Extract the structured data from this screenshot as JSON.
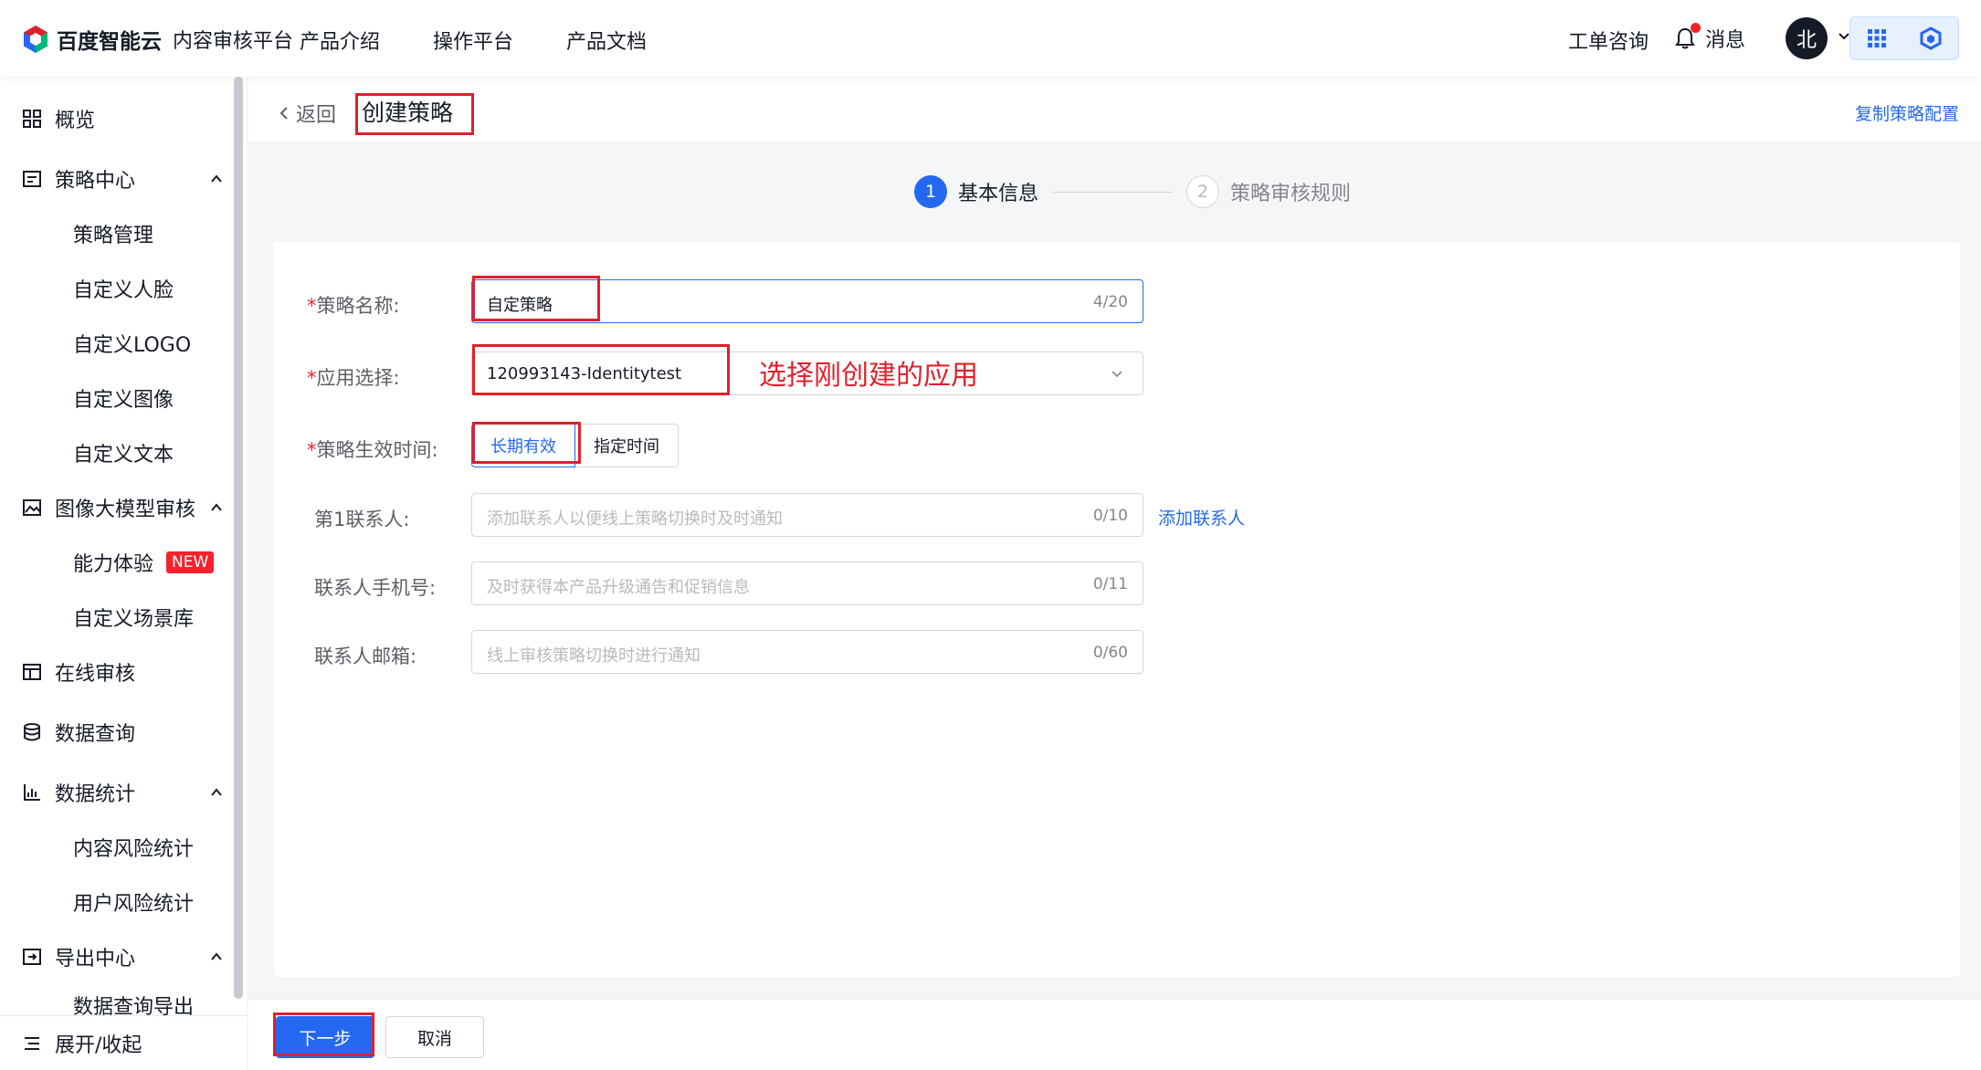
{
  "header": {
    "brand": "百度智能云",
    "product": "内容审核平台",
    "nav": [
      "产品介绍",
      "操作平台",
      "产品文档"
    ],
    "ticket": "工单咨询",
    "messages": "消息",
    "avatar_initial": "北"
  },
  "sidebar": {
    "overview": "概览",
    "strategy_center": "策略中心",
    "strategy_items": [
      "策略管理",
      "自定义人脸",
      "自定义LOGO",
      "自定义图像",
      "自定义文本"
    ],
    "image_model": "图像大模型审核",
    "image_model_items": [
      "能力体验",
      "自定义场景库"
    ],
    "new_badge": "NEW",
    "online_review": "在线审核",
    "data_query": "数据查询",
    "data_stats": "数据统计",
    "data_stats_items": [
      "内容风险统计",
      "用户风险统计"
    ],
    "export_center": "导出中心",
    "export_items": [
      "数据查询导出"
    ],
    "toggle": "展开/收起"
  },
  "page": {
    "back": "返回",
    "title": "创建策略",
    "copy_config": "复制策略配置"
  },
  "steps": [
    {
      "num": "1",
      "label": "基本信息"
    },
    {
      "num": "2",
      "label": "策略审核规则"
    }
  ],
  "form": {
    "required_mark": "*",
    "name_label": "策略名称:",
    "name_value": "自定策略",
    "name_count": "4/20",
    "app_label": "应用选择:",
    "app_value": "120993143-Identitytest",
    "time_label": "策略生效时间:",
    "time_options": [
      "长期有效",
      "指定时间"
    ],
    "contact_label": "第1联系人:",
    "contact_placeholder": "添加联系人以便线上策略切换时及时通知",
    "contact_count": "0/10",
    "add_contact": "添加联系人",
    "phone_label": "联系人手机号:",
    "phone_placeholder": "及时获得本产品升级通告和促销信息",
    "phone_count": "0/11",
    "email_label": "联系人邮箱:",
    "email_placeholder": "线上审核策略切换时进行通知",
    "email_count": "0/60"
  },
  "annotation": "选择刚创建的应用",
  "footer": {
    "next": "下一步",
    "cancel": "取消"
  }
}
